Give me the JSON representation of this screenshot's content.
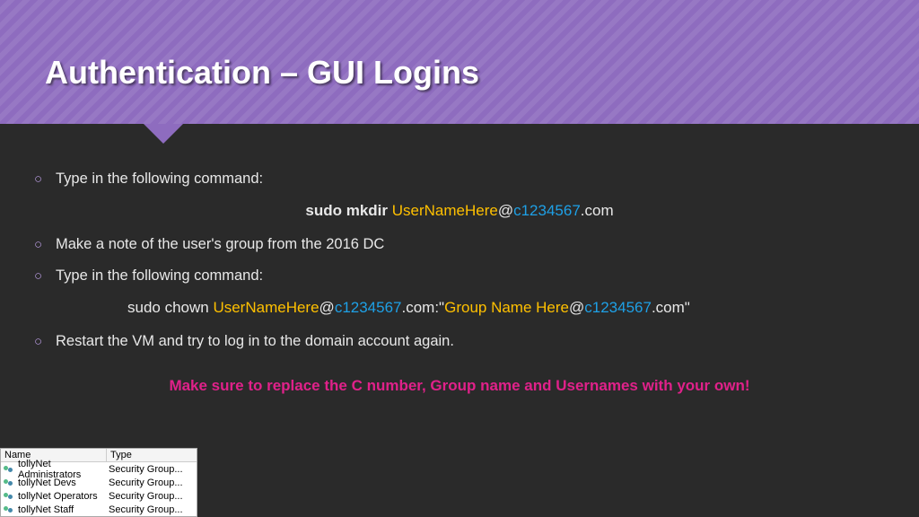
{
  "title": "Authentication – GUI Logins",
  "bullets": {
    "b1": "Type in the following command:",
    "b2": "Make a note of the user's group from the 2016 DC",
    "b3": "Type in the following command:",
    "b4": "Restart the VM and try to log in to the domain account again."
  },
  "cmd1": {
    "prefix": "sudo mkdir ",
    "user": "UserNameHere",
    "at": "@",
    "cnum": "c1234567",
    "suffix": ".com"
  },
  "cmd2": {
    "prefix": "sudo chown ",
    "user": "UserNameHere",
    "at": "@",
    "cnum": "c1234567",
    "mid": ".com:\"",
    "group": "Group Name Here",
    "at2": "@",
    "cnum2": "c1234567",
    "suffix": ".com\""
  },
  "warning": "Make sure to replace the C number, Group name and Usernames with your own!",
  "groups": {
    "head_name": "Name",
    "head_type": "Type",
    "rows": [
      {
        "name": "tollyNet Administrators",
        "type": "Security Group..."
      },
      {
        "name": "tollyNet Devs",
        "type": "Security Group..."
      },
      {
        "name": "tollyNet Operators",
        "type": "Security Group..."
      },
      {
        "name": "tollyNet Staff",
        "type": "Security Group..."
      }
    ]
  }
}
